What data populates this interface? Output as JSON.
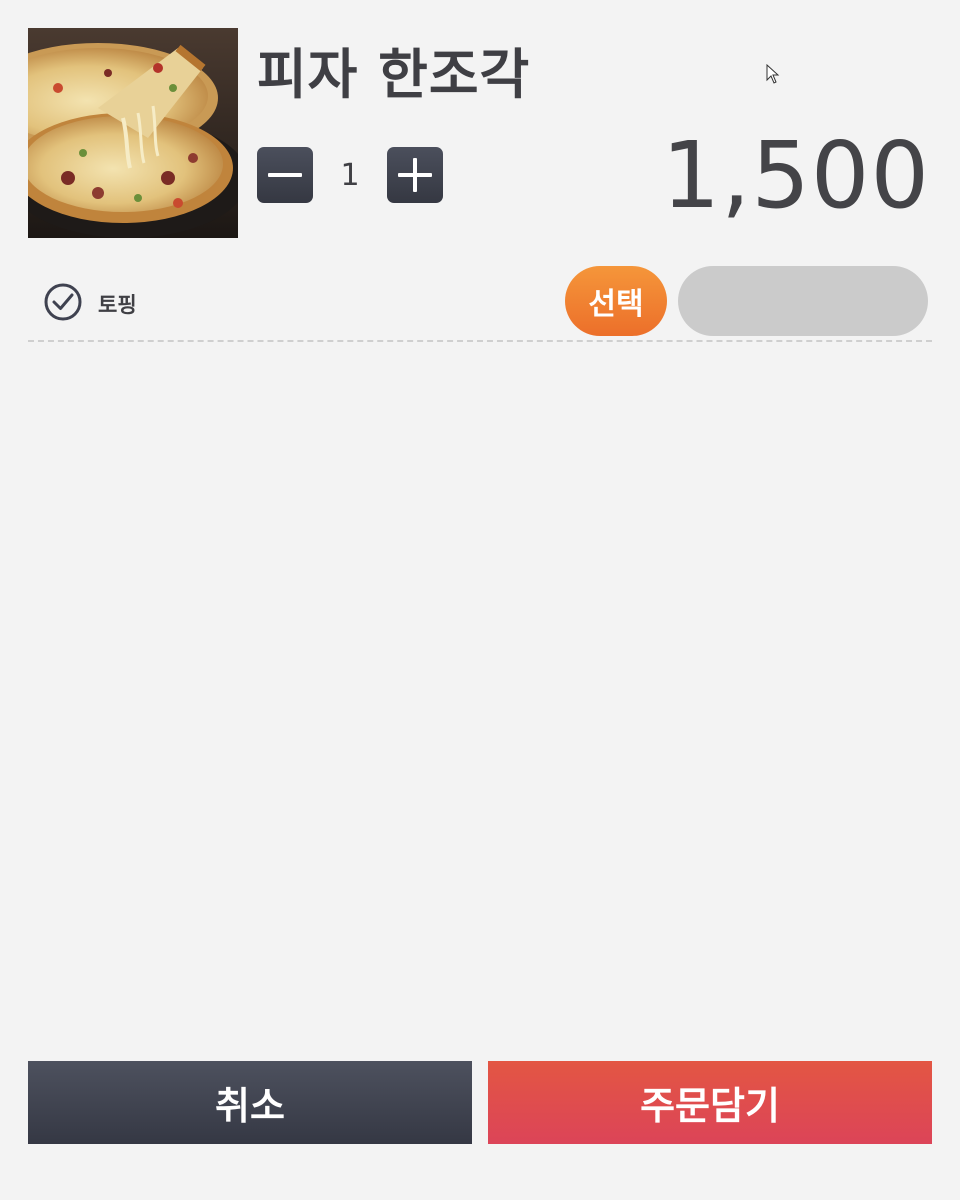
{
  "product": {
    "name": "피자 한조각",
    "image_icon": "pizza-photo",
    "quantity": "1",
    "price": "1,500"
  },
  "stepper": {
    "minus_icon": "minus-icon",
    "plus_icon": "plus-icon"
  },
  "options": [
    {
      "label": "토핑",
      "select_label": "선택",
      "selected_value": ""
    }
  ],
  "actions": {
    "cancel_label": "취소",
    "add_to_order_label": "주문담기"
  },
  "colors": {
    "background": "#f3f3f3",
    "dark_button": "#3f4250",
    "select_accent": "#f08432",
    "primary_red": "#df4d4e",
    "field_gray": "#cbcbcb",
    "text": "#3f3f44"
  }
}
